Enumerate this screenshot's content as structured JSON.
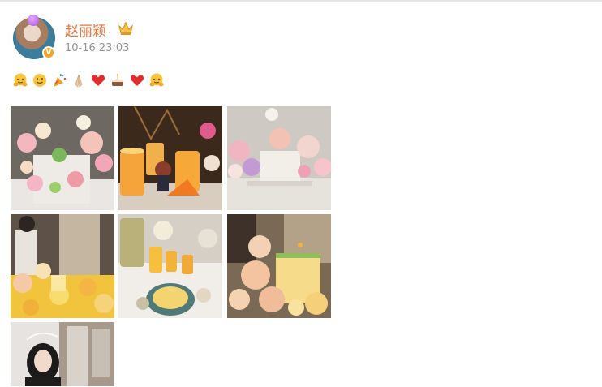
{
  "post": {
    "author": {
      "name": "赵丽颖",
      "verified_badge": "V"
    },
    "timestamp": "10-16 23:03",
    "emojis": [
      "hug-face-emoji",
      "smile-face-emoji",
      "party-popper-emoji",
      "folded-hands-emoji",
      "red-heart-emoji",
      "cake-emoji",
      "red-heart-emoji",
      "hug-face-emoji"
    ],
    "photos": [
      {
        "name": "photo-flower-cake"
      },
      {
        "name": "photo-candles-doll"
      },
      {
        "name": "photo-cake-flowers-window"
      },
      {
        "name": "photo-woman-yellow-flowers"
      },
      {
        "name": "photo-table-candles-dish"
      },
      {
        "name": "photo-woman-cake-roses"
      },
      {
        "name": "photo-woman-selfie"
      }
    ]
  },
  "colors": {
    "username": "#eb7340",
    "timestamp": "#939393",
    "badge": "#f4a51c"
  }
}
